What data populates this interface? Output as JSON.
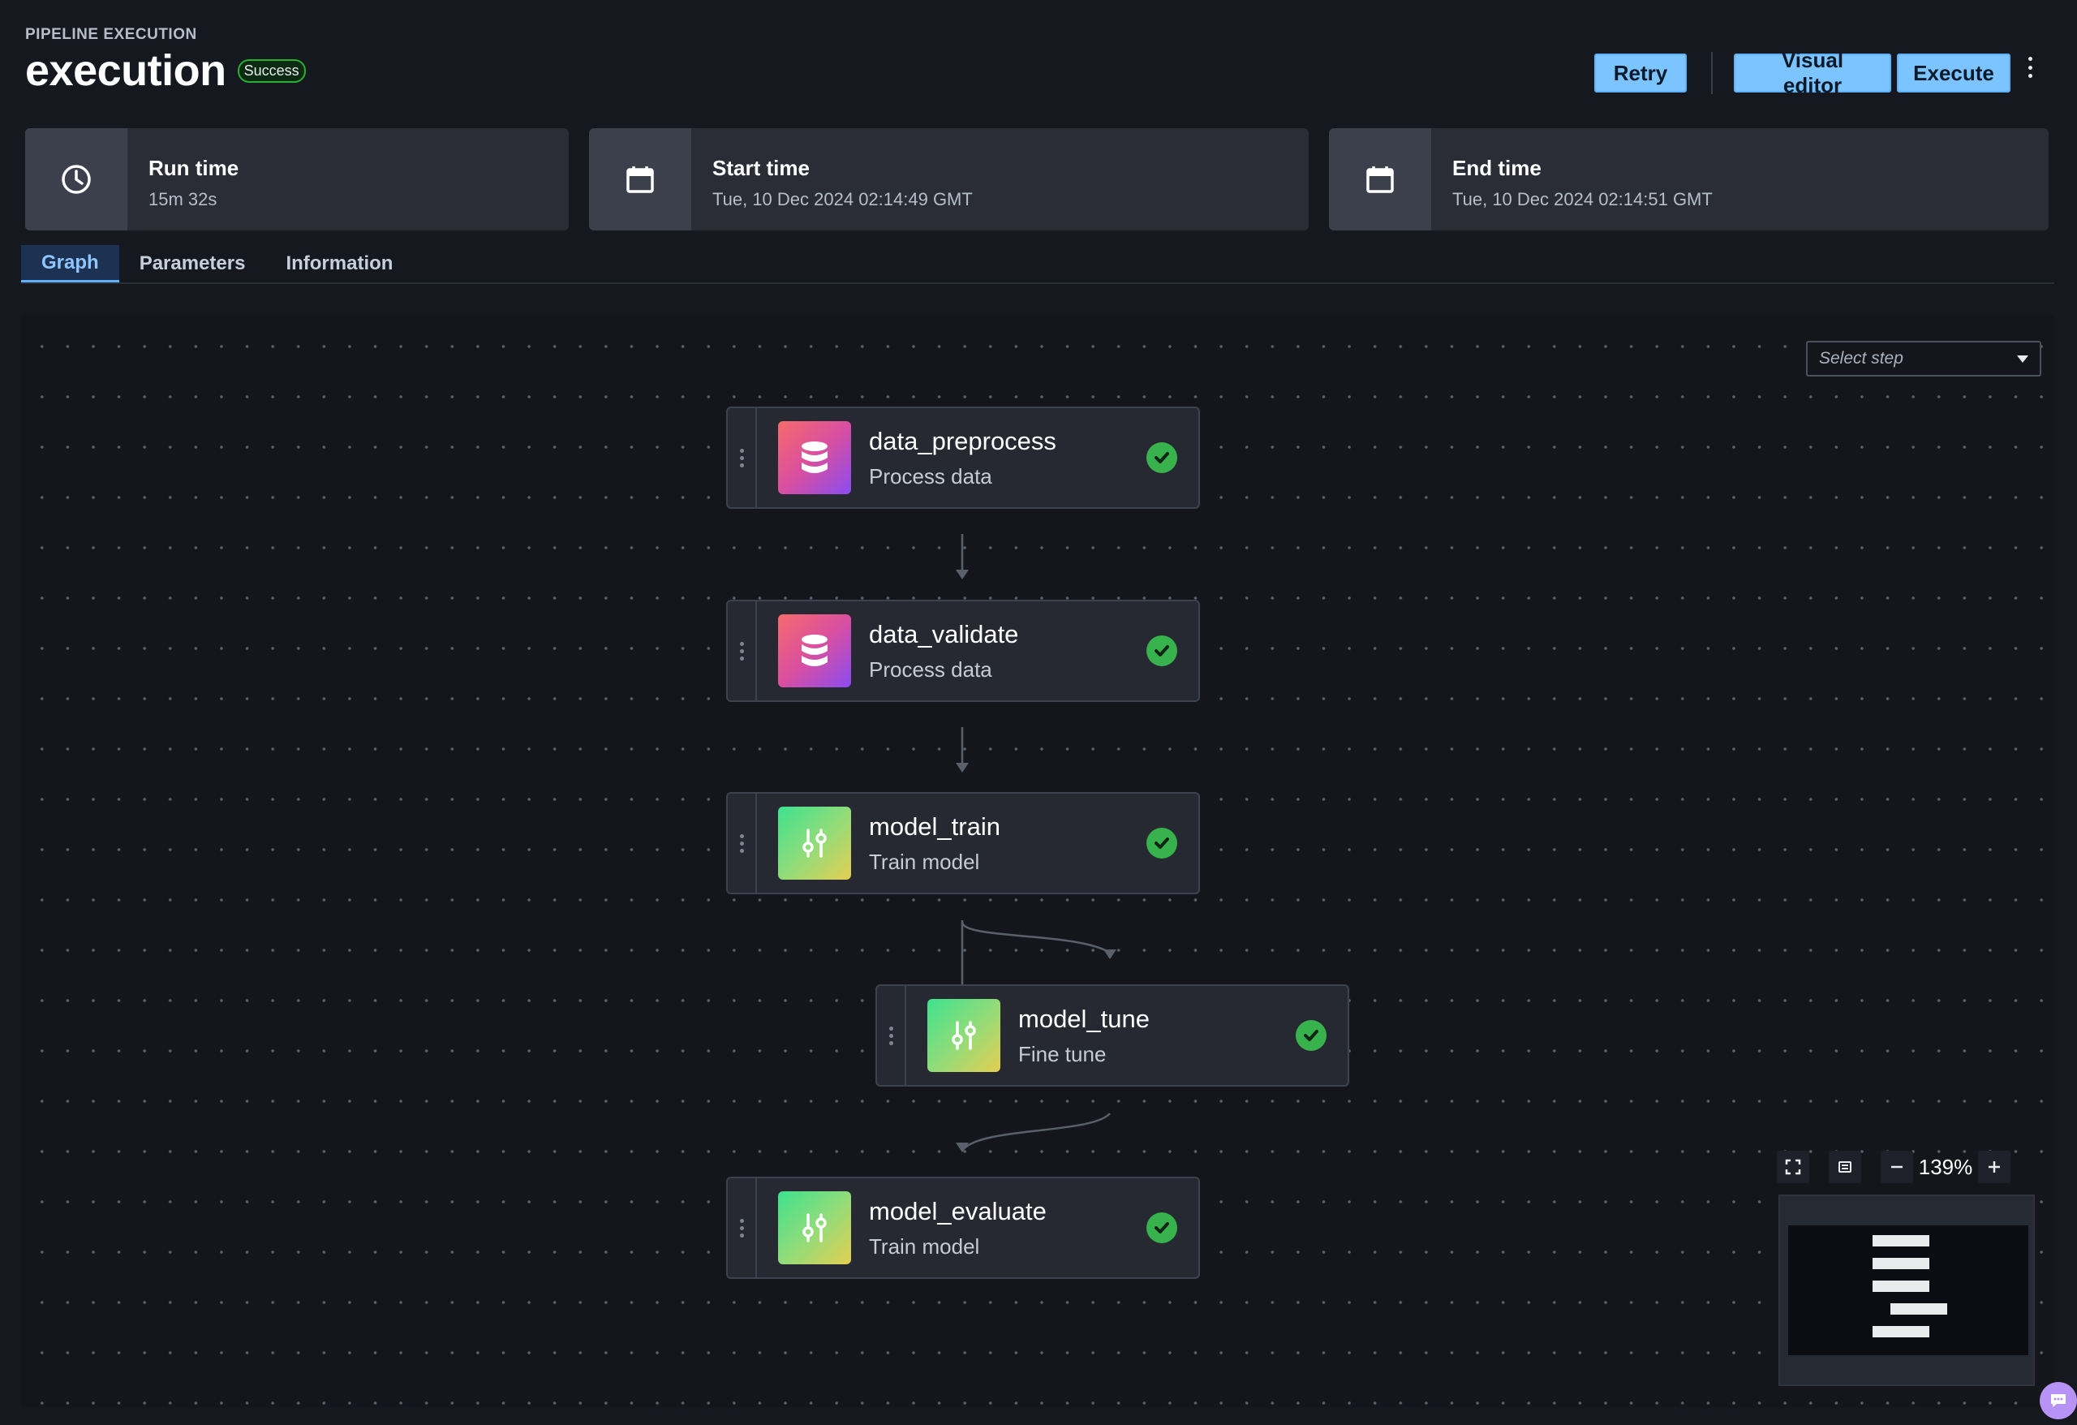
{
  "header": {
    "overline": "PIPELINE EXECUTION",
    "title": "execution",
    "status_badge": "Success",
    "buttons": {
      "retry": "Retry",
      "visual_editor": "Visual editor",
      "execute": "Execute"
    }
  },
  "stats": [
    {
      "label": "Run time",
      "value": "15m 32s",
      "icon": "clock-icon"
    },
    {
      "label": "Start time",
      "value": "Tue, 10 Dec 2024 02:14:49 GMT",
      "icon": "calendar-icon"
    },
    {
      "label": "End time",
      "value": "Tue, 10 Dec 2024 02:14:51 GMT",
      "icon": "calendar-icon"
    }
  ],
  "tabs": [
    {
      "label": "Graph",
      "active": true
    },
    {
      "label": "Parameters",
      "active": false
    },
    {
      "label": "Information",
      "active": false
    }
  ],
  "graph": {
    "select_step_placeholder": "Select step",
    "zoom": "139%",
    "nodes": [
      {
        "name": "data_preprocess",
        "desc": "Process data",
        "icon": "database-icon",
        "status": "success"
      },
      {
        "name": "data_validate",
        "desc": "Process data",
        "icon": "database-icon",
        "status": "success"
      },
      {
        "name": "model_train",
        "desc": "Train model",
        "icon": "sliders-icon",
        "status": "success"
      },
      {
        "name": "model_tune",
        "desc": "Fine tune",
        "icon": "sliders-icon",
        "status": "success"
      },
      {
        "name": "model_evaluate",
        "desc": "Train model",
        "icon": "sliders-icon",
        "status": "success"
      }
    ]
  },
  "colors": {
    "accent": "#7cc4ff",
    "success": "#37b24d",
    "background": "#161820",
    "card": "#2a2d36"
  }
}
